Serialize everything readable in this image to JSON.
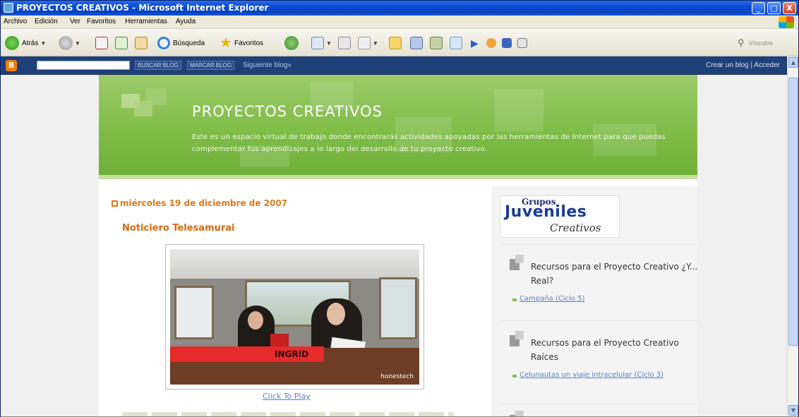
{
  "window": {
    "title": "PROYECTOS CREATIVOS - Microsoft Internet Explorer",
    "minimize": "_",
    "maximize": "□",
    "close": "X"
  },
  "menu": {
    "items": [
      "Archivo",
      "Edición",
      "Ver",
      "Favoritos",
      "Herramientas",
      "Ayuda"
    ]
  },
  "toolbar": {
    "back_label": "Atrás",
    "search_label": "Búsqueda",
    "favorites_label": "Favoritos",
    "links_label": "Vínculos"
  },
  "blogger_nav": {
    "search_button": "BUSCAR BLOG",
    "flag_button": "MARCAR BLOG",
    "next_blog": "Siguiente blog»",
    "right_links": "Crear un blog | Acceder"
  },
  "blog": {
    "title": "PROYECTOS CREATIVOS",
    "description": "Este es un espacio virtual de trabajo donde encontrarás actividades apoyadas por las herramientas de Internet para que puedas complementar tus aprendizajes a lo largo del desarrollo de tu proyecto creativo."
  },
  "post": {
    "date": "miércoles 19 de diciembre de 2007",
    "title": "Noticiero Telesamurai",
    "video_caption_name": "INGRID",
    "video_watermark": "honestech",
    "click_to_play": "Click To Play"
  },
  "sidebar": {
    "logo_top": "Grupos",
    "logo_main": "Juveniles",
    "logo_script": "Creativos",
    "sections": [
      {
        "heading": "Recursos para el Proyecto Creativo ¿Y... Real?",
        "link": "Campaña (Ciclo 5)"
      },
      {
        "heading": "Recursos para el Proyecto Creativo Raíces",
        "link": "Celunautas un viaje intracelular (Ciclo 3)"
      }
    ]
  }
}
